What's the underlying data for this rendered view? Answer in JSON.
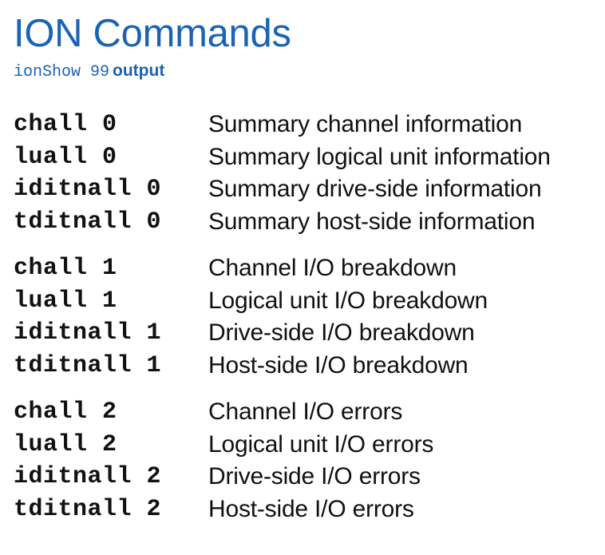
{
  "title": "ION Commands",
  "subtitle": {
    "command": "ionShow 99",
    "text": "output"
  },
  "groups": [
    {
      "rows": [
        {
          "command": "chall 0",
          "description": "Summary channel information"
        },
        {
          "command": "luall 0",
          "description": "Summary logical unit information"
        },
        {
          "command": "iditnall 0",
          "description": "Summary drive-side information"
        },
        {
          "command": "tditnall 0",
          "description": "Summary host-side information"
        }
      ]
    },
    {
      "rows": [
        {
          "command": "chall 1",
          "description": "Channel I/O breakdown"
        },
        {
          "command": "luall 1",
          "description": "Logical unit I/O breakdown"
        },
        {
          "command": "iditnall 1",
          "description": "Drive-side I/O breakdown"
        },
        {
          "command": "tditnall 1",
          "description": "Host-side I/O breakdown"
        }
      ]
    },
    {
      "rows": [
        {
          "command": "chall 2",
          "description": "Channel I/O errors"
        },
        {
          "command": "luall 2",
          "description": "Logical unit I/O errors"
        },
        {
          "command": "iditnall 2",
          "description": "Drive-side I/O errors"
        },
        {
          "command": "tditnall 2",
          "description": "Host-side I/O errors"
        }
      ]
    }
  ]
}
